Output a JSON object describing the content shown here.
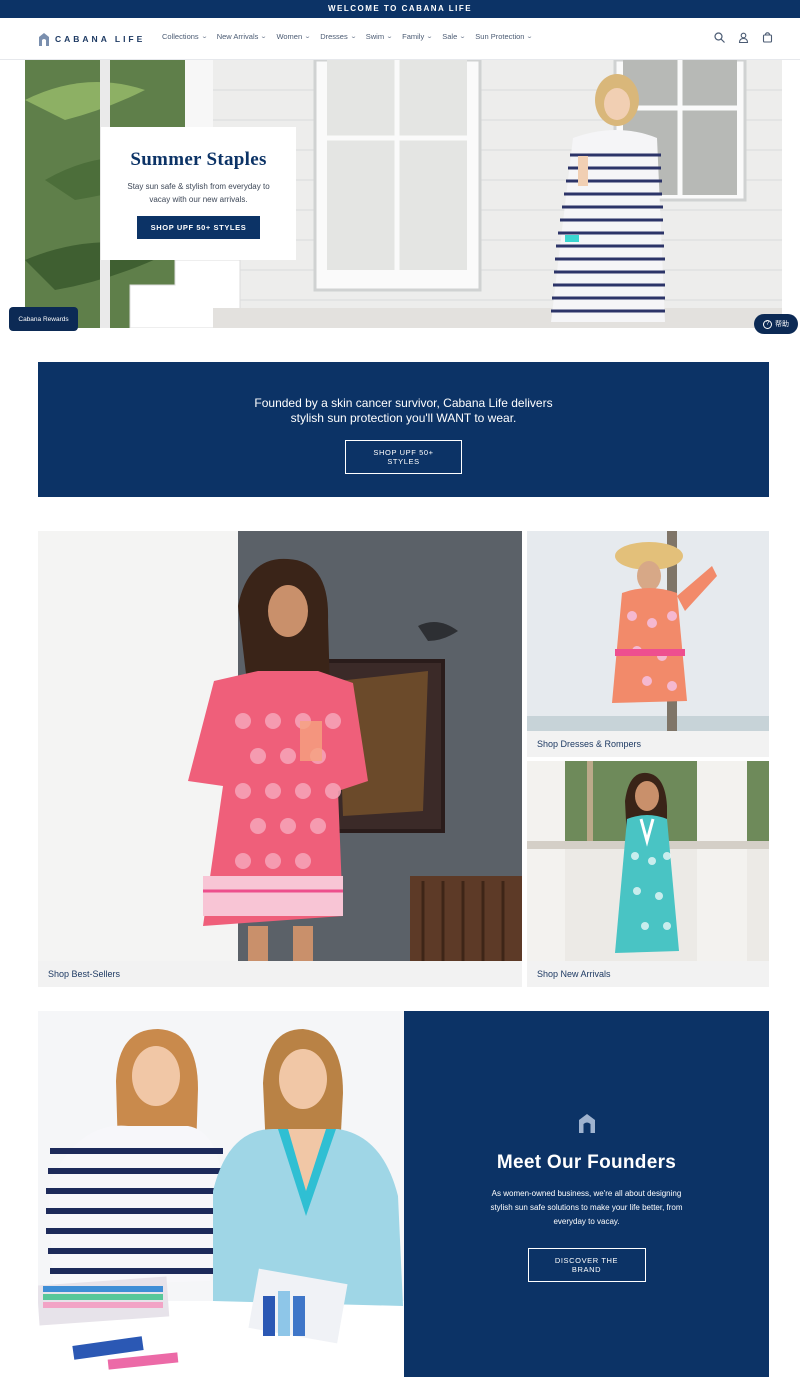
{
  "announcement": "WELCOME TO CABANA LIFE",
  "brand": {
    "logo_text": "CABANA LIFE"
  },
  "nav": {
    "items": [
      {
        "label": "Collections"
      },
      {
        "label": "New Arrivals"
      },
      {
        "label": "Women"
      },
      {
        "label": "Dresses"
      },
      {
        "label": "Swim"
      },
      {
        "label": "Family"
      },
      {
        "label": "Sale"
      },
      {
        "label": "Sun Protection"
      }
    ],
    "icons": [
      "search-icon",
      "account-icon",
      "cart-icon"
    ]
  },
  "hero": {
    "title": "Summer Staples",
    "text": "Stay sun safe & stylish from everyday to vacay with our new arrivals.",
    "button": "SHOP UPF 50+ STYLES"
  },
  "widgets": {
    "rewards": "Cabana Rewards",
    "help": "帮助"
  },
  "mission": {
    "text": "Founded by a skin cancer survivor, Cabana Life delivers stylish sun protection you'll WANT to wear.",
    "button": "SHOP UPF 50+ STYLES"
  },
  "tiles": {
    "best_sellers": "Shop Best-Sellers",
    "dresses": "Shop Dresses & Rompers",
    "new_arrivals": "Shop New Arrivals"
  },
  "founders": {
    "title": "Meet Our Founders",
    "text": "As women-owned business, we're all about designing stylish sun safe solutions to make your life better, from everyday to vacay.",
    "button": "DISCOVER THE BRAND"
  },
  "colors": {
    "navy": "#0c3366",
    "white": "#ffffff",
    "tile_label_bg": "#f2f2f2"
  }
}
